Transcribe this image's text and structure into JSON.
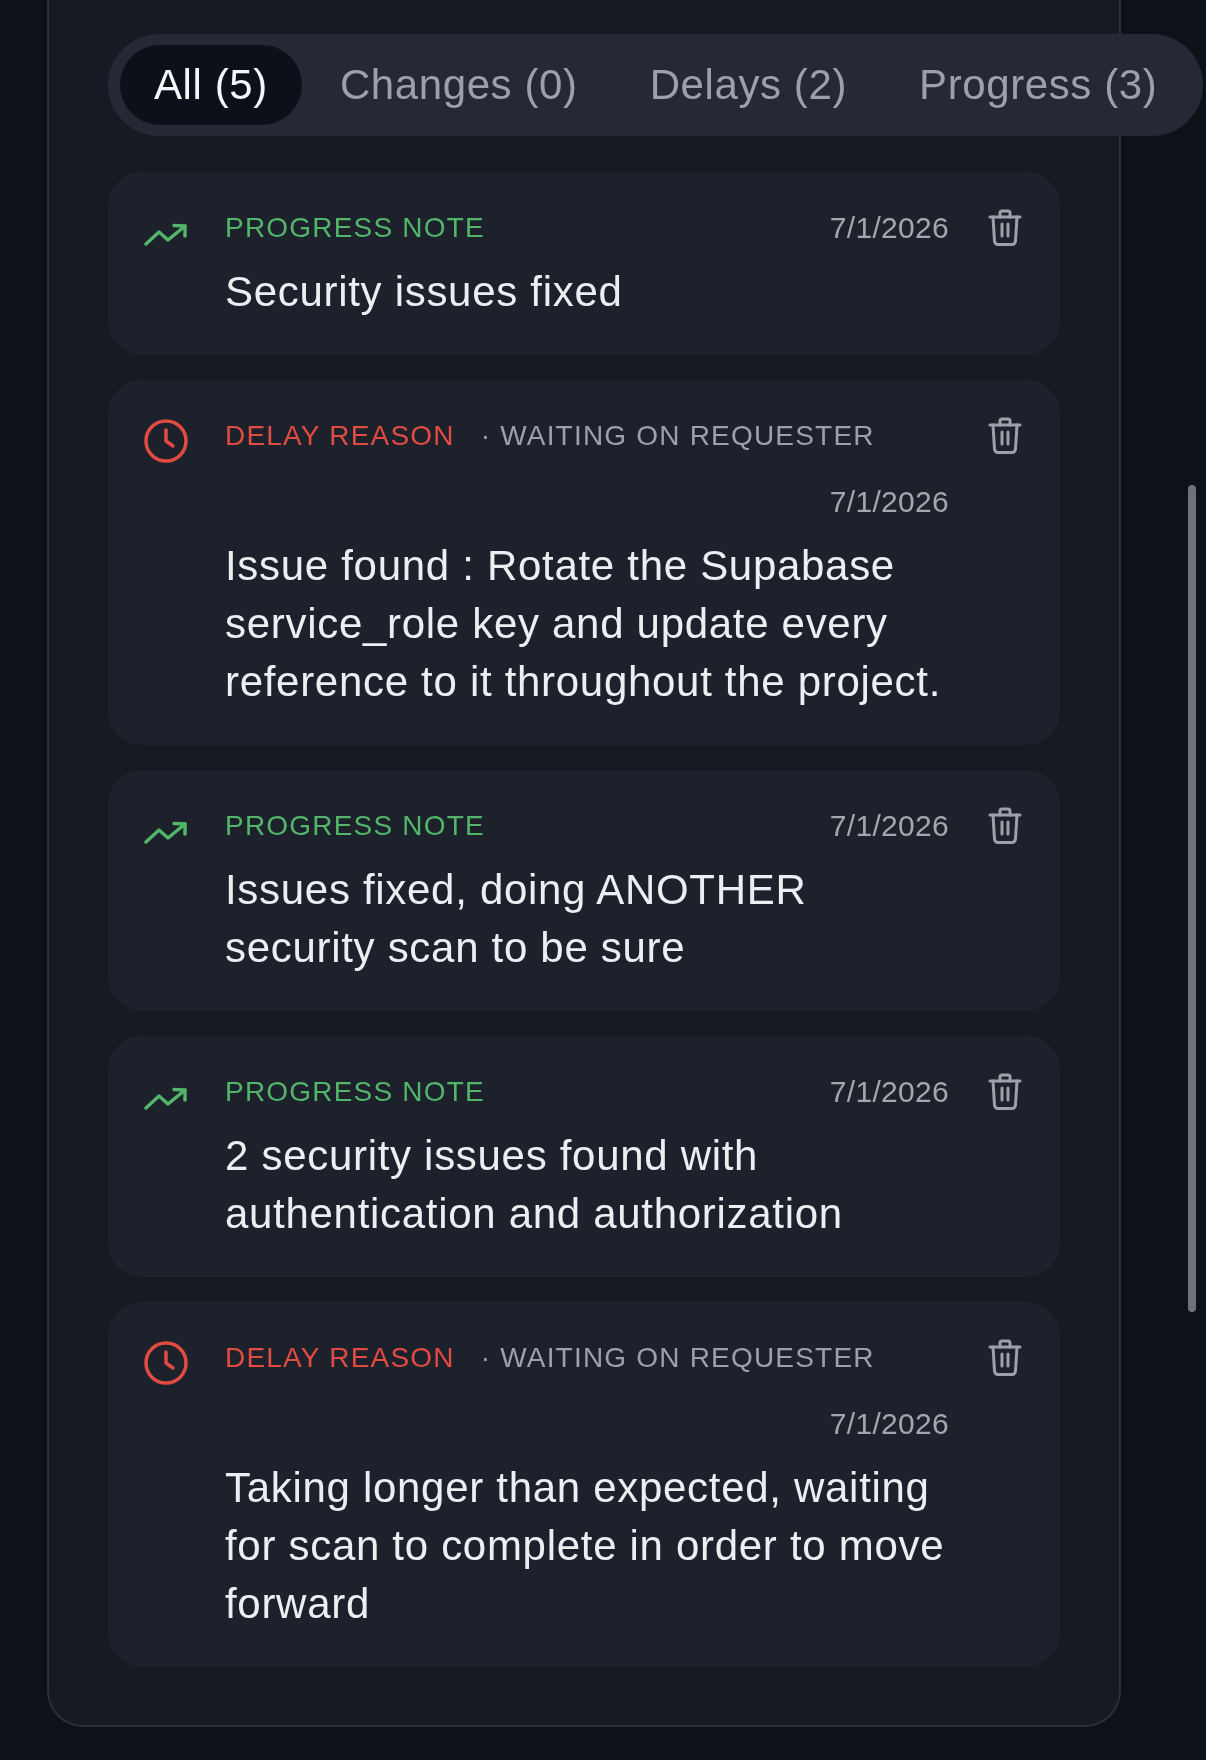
{
  "tabs": [
    {
      "label": "All (5)",
      "selected": true
    },
    {
      "label": "Changes (0)",
      "selected": false
    },
    {
      "label": "Delays (2)",
      "selected": false
    },
    {
      "label": "Progress (3)",
      "selected": false
    }
  ],
  "entries": [
    {
      "kind": "progress",
      "label": "PROGRESS NOTE",
      "date": "7/1/2026",
      "text": "Security issues fixed"
    },
    {
      "kind": "delay",
      "label": "DELAY REASON",
      "detail": "· WAITING ON REQUESTER",
      "date": "7/1/2026",
      "text": "Issue found : Rotate the Supabase service_role key and update every reference to it throughout the project."
    },
    {
      "kind": "progress",
      "label": "PROGRESS NOTE",
      "date": "7/1/2026",
      "text": "Issues fixed, doing ANOTHER security scan to be sure"
    },
    {
      "kind": "progress",
      "label": "PROGRESS NOTE",
      "date": "7/1/2026",
      "text": "2 security issues found with authentication and authorization"
    },
    {
      "kind": "delay",
      "label": "DELAY REASON",
      "detail": "· WAITING ON REQUESTER",
      "date": "7/1/2026",
      "text": "Taking longer than expected, waiting for scan to complete in order to move forward"
    }
  ]
}
